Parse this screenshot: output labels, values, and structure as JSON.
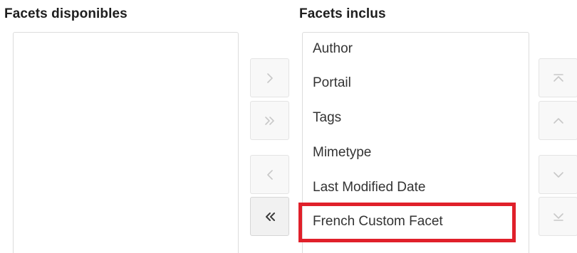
{
  "available_panel": {
    "title": "Facets disponibles",
    "items": []
  },
  "included_panel": {
    "title": "Facets inclus",
    "items": [
      "Author",
      "Portail",
      "Tags",
      "Mimetype",
      "Last Modified Date",
      "French Custom Facet"
    ],
    "highlighted_item": "French Custom Facet"
  },
  "transfer_buttons": {
    "move_right": "chevron-right-icon",
    "move_all_right": "double-chevron-right-icon",
    "move_left": "chevron-left-icon",
    "move_all_left": "double-chevron-left-icon"
  },
  "order_buttons": {
    "move_to_top": "arrow-to-top-icon",
    "move_up": "chevron-up-icon",
    "move_down": "chevron-down-icon",
    "move_to_bottom": "arrow-to-bottom-icon"
  },
  "colors": {
    "highlight_border": "#e0202a",
    "disabled_icon": "#c8c8c8",
    "enabled_icon": "#3a3a3a"
  }
}
